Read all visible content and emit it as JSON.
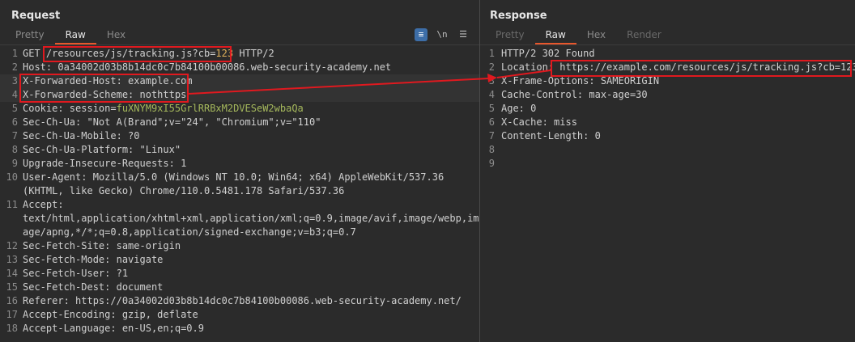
{
  "request": {
    "title": "Request",
    "tabs": [
      {
        "label": "Pretty",
        "active": false
      },
      {
        "label": "Raw",
        "active": true
      },
      {
        "label": "Hex",
        "active": false
      }
    ],
    "tools": {
      "wrap_icon": "wrap-lines-icon",
      "newline_label": "\\n",
      "menu_icon": "hamburger-menu-icon"
    },
    "lines": [
      {
        "n": "1",
        "parts": [
          {
            "t": "GET "
          },
          {
            "t": "/resources/js/tracking.js?cb="
          },
          {
            "t": "123",
            "c": "num"
          },
          {
            "t": " HTTP/2"
          }
        ]
      },
      {
        "n": "2",
        "parts": [
          {
            "t": "Host: 0a34002d03b8b14dc0c7b84100b00086.web-security-academy.net"
          }
        ]
      },
      {
        "n": "3",
        "parts": [
          {
            "t": "X-Forwarded-Host: example.com"
          }
        ]
      },
      {
        "n": "4",
        "parts": [
          {
            "t": "X-Forwarded-Scheme: nothttps"
          }
        ]
      },
      {
        "n": "5",
        "parts": [
          {
            "t": "Cookie: session="
          },
          {
            "t": "fuXNYM9xI55GrlRRBxM2DVESeW2wbaQa",
            "c": "cookie"
          }
        ]
      },
      {
        "n": "6",
        "parts": [
          {
            "t": "Sec-Ch-Ua: \"Not A(Brand\";v=\"24\", \"Chromium\";v=\"110\""
          }
        ]
      },
      {
        "n": "7",
        "parts": [
          {
            "t": "Sec-Ch-Ua-Mobile: ?0"
          }
        ]
      },
      {
        "n": "8",
        "parts": [
          {
            "t": "Sec-Ch-Ua-Platform: \"Linux\""
          }
        ]
      },
      {
        "n": "9",
        "parts": [
          {
            "t": "Upgrade-Insecure-Requests: 1"
          }
        ]
      },
      {
        "n": "10",
        "parts": [
          {
            "t": "User-Agent: Mozilla/5.0 (Windows NT 10.0; Win64; x64) AppleWebKit/537.36"
          }
        ]
      },
      {
        "n": "",
        "parts": [
          {
            "t": "(KHTML, like Gecko) Chrome/110.0.5481.178 Safari/537.36"
          }
        ]
      },
      {
        "n": "11",
        "parts": [
          {
            "t": "Accept:"
          }
        ]
      },
      {
        "n": "",
        "parts": [
          {
            "t": "text/html,application/xhtml+xml,application/xml;q=0.9,image/avif,image/webp,im"
          }
        ]
      },
      {
        "n": "",
        "parts": [
          {
            "t": "age/apng,*/*;q=0.8,application/signed-exchange;v=b3;q=0.7"
          }
        ]
      },
      {
        "n": "12",
        "parts": [
          {
            "t": "Sec-Fetch-Site: same-origin"
          }
        ]
      },
      {
        "n": "13",
        "parts": [
          {
            "t": "Sec-Fetch-Mode: navigate"
          }
        ]
      },
      {
        "n": "14",
        "parts": [
          {
            "t": "Sec-Fetch-User: ?1"
          }
        ]
      },
      {
        "n": "15",
        "parts": [
          {
            "t": "Sec-Fetch-Dest: document"
          }
        ]
      },
      {
        "n": "16",
        "parts": [
          {
            "t": "Referer: https://0a34002d03b8b14dc0c7b84100b00086.web-security-academy.net/"
          }
        ]
      },
      {
        "n": "17",
        "parts": [
          {
            "t": "Accept-Encoding: gzip, deflate"
          }
        ]
      },
      {
        "n": "18",
        "parts": [
          {
            "t": "Accept-Language: en-US,en;q=0.9"
          }
        ]
      }
    ]
  },
  "response": {
    "title": "Response",
    "tabs": [
      {
        "label": "Pretty",
        "active": false,
        "dim": true
      },
      {
        "label": "Raw",
        "active": true
      },
      {
        "label": "Hex",
        "active": false
      },
      {
        "label": "Render",
        "active": false,
        "dim": true
      }
    ],
    "lines": [
      {
        "n": "1",
        "parts": [
          {
            "t": "HTTP/2 302 Found"
          }
        ]
      },
      {
        "n": "2",
        "parts": [
          {
            "t": "Location: "
          },
          {
            "t": "https://example.com/resources/js/tracking.js?cb=123"
          }
        ]
      },
      {
        "n": "3",
        "parts": [
          {
            "t": "X-Frame-Options: SAMEORIGIN"
          }
        ]
      },
      {
        "n": "4",
        "parts": [
          {
            "t": "Cache-Control: max-age=30"
          }
        ]
      },
      {
        "n": "5",
        "parts": [
          {
            "t": "Age: 0"
          }
        ]
      },
      {
        "n": "6",
        "parts": [
          {
            "t": "X-Cache: miss"
          }
        ]
      },
      {
        "n": "7",
        "parts": [
          {
            "t": "Content-Length: 0"
          }
        ]
      },
      {
        "n": "8",
        "parts": [
          {
            "t": ""
          }
        ]
      },
      {
        "n": "9",
        "parts": [
          {
            "t": ""
          }
        ]
      }
    ]
  },
  "colors": {
    "accent_tab": "#e8572c",
    "annotation_red": "#e0191f",
    "cookie_green": "#a5b85c",
    "number_orange": "#e0b15a"
  }
}
